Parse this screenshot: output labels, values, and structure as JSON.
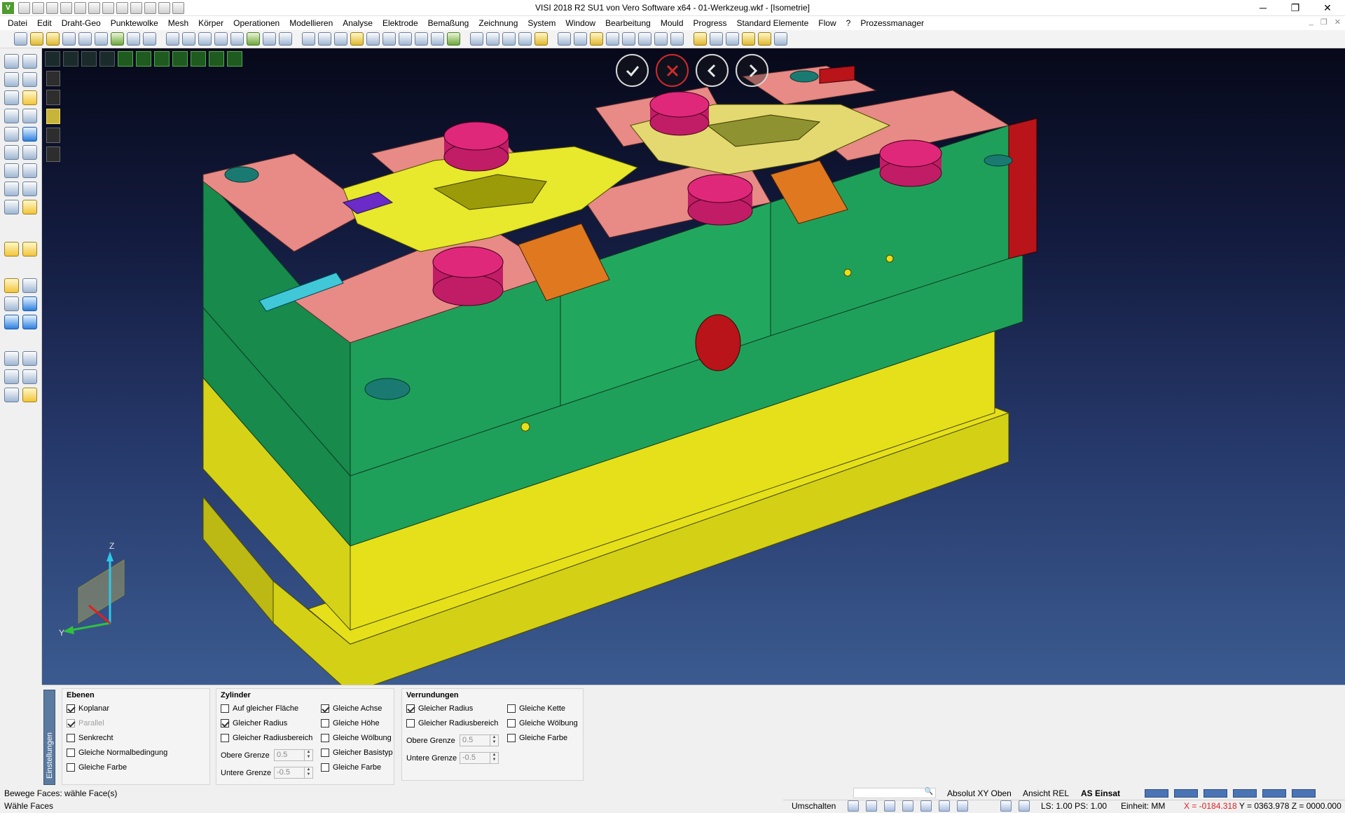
{
  "window": {
    "title": "VISI 2018 R2 SU1 von Vero Software x64 - 01-Werkzeug.wkf - [Isometrie]",
    "app_icon": "V"
  },
  "window_controls": {
    "minimize": "─",
    "restore": "❐",
    "close": "✕"
  },
  "menu": [
    "Datei",
    "Edit",
    "Draht-Geo",
    "Punktewolke",
    "Mesh",
    "Körper",
    "Operationen",
    "Modellieren",
    "Analyse",
    "Elektrode",
    "Bemaßung",
    "Zeichnung",
    "System",
    "Window",
    "Bearbeitung",
    "Mould",
    "Progress",
    "Standard Elemente",
    "Flow",
    "?",
    "Prozessmanager"
  ],
  "mdi_controls": {
    "minimize": "_",
    "restore": "❐",
    "close": "✕"
  },
  "viewport": {
    "axis_labels": {
      "z": "Z",
      "y": "Y"
    },
    "nav_icons": [
      "confirm-icon",
      "cancel-icon",
      "previous-icon",
      "next-icon"
    ]
  },
  "panel": {
    "tab_label": "Einstellungen",
    "ebenen": {
      "title": "Ebenen",
      "items": [
        {
          "label": "Koplanar",
          "checked": true,
          "disabled": false
        },
        {
          "label": "Parallel",
          "checked": true,
          "disabled": true
        },
        {
          "label": "Senkrecht",
          "checked": false,
          "disabled": false
        },
        {
          "label": "Gleiche Normalbedingung",
          "checked": false,
          "disabled": false
        },
        {
          "label": "Gleiche Farbe",
          "checked": false,
          "disabled": false
        }
      ]
    },
    "zylinder": {
      "title": "Zylinder",
      "col1": [
        {
          "label": "Auf gleicher Fläche",
          "checked": false
        },
        {
          "label": "Gleicher Radius",
          "checked": true
        },
        {
          "label": "Gleicher Radiusbereich",
          "checked": false
        }
      ],
      "col2": [
        {
          "label": "Gleiche Achse",
          "checked": true
        },
        {
          "label": "Gleiche Höhe",
          "checked": false
        },
        {
          "label": "Gleiche Wölbung",
          "checked": false
        },
        {
          "label": "Gleicher Basistyp",
          "checked": false
        },
        {
          "label": "Gleiche Farbe",
          "checked": false
        }
      ],
      "upper_label": "Obere Grenze",
      "upper_value": "0.5",
      "lower_label": "Untere Grenze",
      "lower_value": "-0.5"
    },
    "verrundungen": {
      "title": "Verrundungen",
      "col1": [
        {
          "label": "Gleicher Radius",
          "checked": true
        },
        {
          "label": "Gleicher Radiusbereich",
          "checked": false
        }
      ],
      "col2": [
        {
          "label": "Gleiche Kette",
          "checked": false
        },
        {
          "label": "Gleiche Wölbung",
          "checked": false
        },
        {
          "label": "Gleiche Farbe",
          "checked": false
        }
      ],
      "upper_label": "Obere Grenze",
      "upper_value": "0.5",
      "lower_label": "Untere Grenze",
      "lower_value": "-0.5"
    }
  },
  "status": {
    "prompt": "Bewege Faces: wähle Face(s)",
    "message": "Wähle Faces",
    "absolut": "Absolut XY Oben",
    "ansicht": "Ansicht REL",
    "as_einsat": "AS Einsat",
    "umschalten": "Umschalten",
    "ls_ps": "LS: 1.00 PS: 1.00",
    "einheit": "Einheit: MM",
    "coord_x": "X = -0184.318",
    "coord_y": "Y = 0363.978",
    "coord_z": "Z = 0000.000"
  },
  "colors": {
    "plate_green": "#1fa05a",
    "top_pink": "#e88a86",
    "cylinder_magenta": "#e0287a",
    "base_yellow": "#e6e01a",
    "insert_yellow": "#e8e82c",
    "slider_orange": "#e07820",
    "red_part": "#b8141a",
    "viewport_top": "#07091a",
    "viewport_bottom": "#3b5b90"
  }
}
